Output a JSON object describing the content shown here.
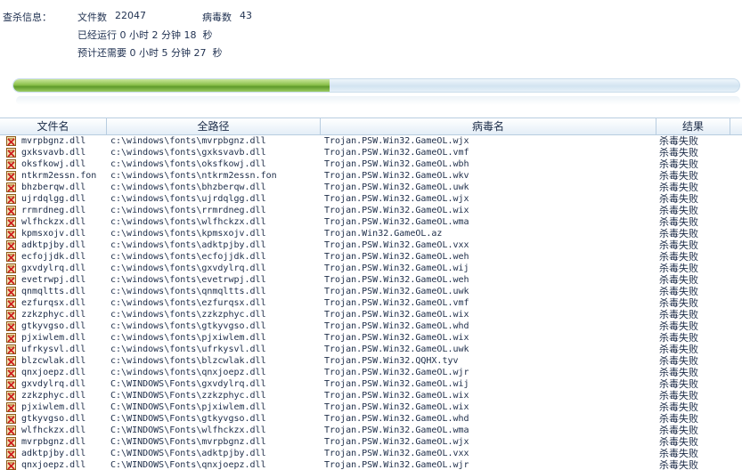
{
  "scan_info": {
    "label": "查杀信息：",
    "files_label": "文件数",
    "files_value": "22047",
    "virus_label": "病毒数",
    "virus_value": "43",
    "elapsed": "已经运行 0 小时 2 分钟 18  秒",
    "remaining": "预计还需要 0 小时 5 分钟 27  秒"
  },
  "progress": {
    "fraction": 0.436,
    "fill_color": "#7fb640"
  },
  "table": {
    "columns": [
      "文件名",
      "全路径",
      "病毒名",
      "结果"
    ],
    "icon": "virus-file-icon",
    "rows": [
      [
        "mvrpbgnz.dll",
        "c:\\windows\\fonts\\mvrpbgnz.dll",
        "Trojan.PSW.Win32.GameOL.wjx",
        "杀毒失败"
      ],
      [
        "gxksvavb.dll",
        "c:\\windows\\fonts\\gxksvavb.dll",
        "Trojan.PSW.Win32.GameOL.vmf",
        "杀毒失败"
      ],
      [
        "oksfkowj.dll",
        "c:\\windows\\fonts\\oksfkowj.dll",
        "Trojan.PSW.Win32.GameOL.wbh",
        "杀毒失败"
      ],
      [
        "ntkrm2essn.fon",
        "c:\\windows\\fonts\\ntkrm2essn.fon",
        "Trojan.PSW.Win32.GameOL.wkv",
        "杀毒失败"
      ],
      [
        "bhzberqw.dll",
        "c:\\windows\\fonts\\bhzberqw.dll",
        "Trojan.PSW.Win32.GameOL.uwk",
        "杀毒失败"
      ],
      [
        "ujrdqlgg.dll",
        "c:\\windows\\fonts\\ujrdqlgg.dll",
        "Trojan.PSW.Win32.GameOL.wjx",
        "杀毒失败"
      ],
      [
        "rrmrdneg.dll",
        "c:\\windows\\fonts\\rrmrdneg.dll",
        "Trojan.PSW.Win32.GameOL.wix",
        "杀毒失败"
      ],
      [
        "wlfhckzx.dll",
        "c:\\windows\\fonts\\wlfhckzx.dll",
        "Trojan.PSW.Win32.GameOL.wma",
        "杀毒失败"
      ],
      [
        "kpmsxojv.dll",
        "c:\\windows\\fonts\\kpmsxojv.dll",
        "Trojan.Win32.GameOL.az",
        "杀毒失败"
      ],
      [
        "adktpjby.dll",
        "c:\\windows\\fonts\\adktpjby.dll",
        "Trojan.PSW.Win32.GameOL.vxx",
        "杀毒失败"
      ],
      [
        "ecfojjdk.dll",
        "c:\\windows\\fonts\\ecfojjdk.dll",
        "Trojan.PSW.Win32.GameOL.weh",
        "杀毒失败"
      ],
      [
        "gxvdylrq.dll",
        "c:\\windows\\fonts\\gxvdylrq.dll",
        "Trojan.PSW.Win32.GameOL.wij",
        "杀毒失败"
      ],
      [
        "evetrwpj.dll",
        "c:\\windows\\fonts\\evetrwpj.dll",
        "Trojan.PSW.Win32.GameOL.weh",
        "杀毒失败"
      ],
      [
        "qnmqltts.dll",
        "c:\\windows\\fonts\\qnmqltts.dll",
        "Trojan.PSW.Win32.GameOL.uwk",
        "杀毒失败"
      ],
      [
        "ezfurqsx.dll",
        "c:\\windows\\fonts\\ezfurqsx.dll",
        "Trojan.PSW.Win32.GameOL.vmf",
        "杀毒失败"
      ],
      [
        "zzkzphyc.dll",
        "c:\\windows\\fonts\\zzkzphyc.dll",
        "Trojan.PSW.Win32.GameOL.wix",
        "杀毒失败"
      ],
      [
        "gtkyvgso.dll",
        "c:\\windows\\fonts\\gtkyvgso.dll",
        "Trojan.PSW.Win32.GameOL.whd",
        "杀毒失败"
      ],
      [
        "pjxiwlem.dll",
        "c:\\windows\\fonts\\pjxiwlem.dll",
        "Trojan.PSW.Win32.GameOL.wix",
        "杀毒失败"
      ],
      [
        "ufrkysvl.dll",
        "c:\\windows\\fonts\\ufrkysvl.dll",
        "Trojan.PSW.Win32.GameOL.uwk",
        "杀毒失败"
      ],
      [
        "blzcwlak.dll",
        "c:\\windows\\fonts\\blzcwlak.dll",
        "Trojan.PSW.Win32.QQHX.tyv",
        "杀毒失败"
      ],
      [
        "qnxjoepz.dll",
        "c:\\windows\\fonts\\qnxjoepz.dll",
        "Trojan.PSW.Win32.GameOL.wjr",
        "杀毒失败"
      ],
      [
        "gxvdylrq.dll",
        "C:\\WINDOWS\\Fonts\\gxvdylrq.dll",
        "Trojan.PSW.Win32.GameOL.wij",
        "杀毒失败"
      ],
      [
        "zzkzphyc.dll",
        "C:\\WINDOWS\\Fonts\\zzkzphyc.dll",
        "Trojan.PSW.Win32.GameOL.wix",
        "杀毒失败"
      ],
      [
        "pjxiwlem.dll",
        "C:\\WINDOWS\\Fonts\\pjxiwlem.dll",
        "Trojan.PSW.Win32.GameOL.wix",
        "杀毒失败"
      ],
      [
        "gtkyvgso.dll",
        "C:\\WINDOWS\\Fonts\\gtkyvgso.dll",
        "Trojan.PSW.Win32.GameOL.whd",
        "杀毒失败"
      ],
      [
        "wlfhckzx.dll",
        "C:\\WINDOWS\\Fonts\\wlfhckzx.dll",
        "Trojan.PSW.Win32.GameOL.wma",
        "杀毒失败"
      ],
      [
        "mvrpbgnz.dll",
        "C:\\WINDOWS\\Fonts\\mvrpbgnz.dll",
        "Trojan.PSW.Win32.GameOL.wjx",
        "杀毒失败"
      ],
      [
        "adktpjby.dll",
        "C:\\WINDOWS\\Fonts\\adktpjby.dll",
        "Trojan.PSW.Win32.GameOL.vxx",
        "杀毒失败"
      ],
      [
        "qnxjoepz.dll",
        "C:\\WINDOWS\\Fonts\\qnxjoepz.dll",
        "Trojan.PSW.Win32.GameOL.wjr",
        "杀毒失败"
      ]
    ]
  }
}
